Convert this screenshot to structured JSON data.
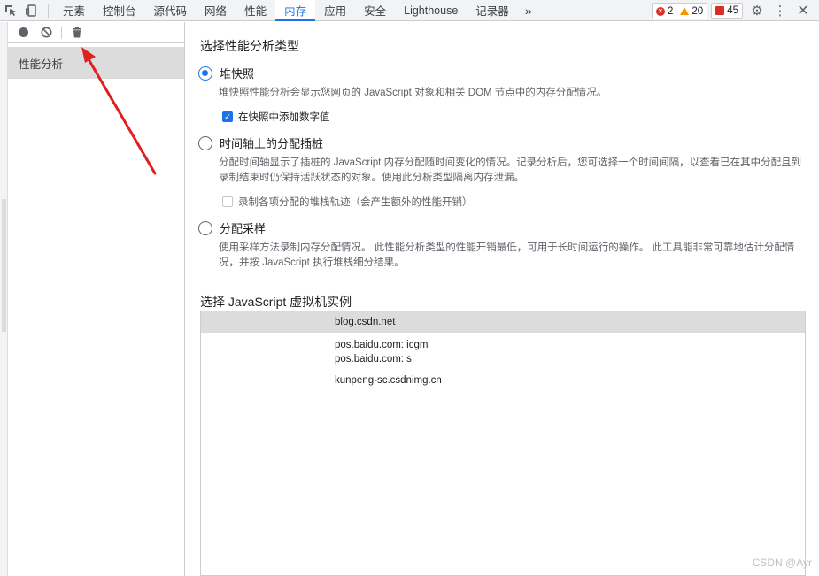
{
  "toolbar": {
    "inspect_icon": "cursor-select-icon",
    "device_icon": "device-toggle-icon",
    "tabs": [
      {
        "label": "元素"
      },
      {
        "label": "控制台"
      },
      {
        "label": "源代码"
      },
      {
        "label": "网络"
      },
      {
        "label": "性能"
      },
      {
        "label": "内存"
      },
      {
        "label": "应用"
      },
      {
        "label": "安全"
      },
      {
        "label": "Lighthouse"
      },
      {
        "label": "记录器"
      }
    ],
    "active_tab": "内存",
    "more_label": "»",
    "errors_count": "2",
    "warnings_count": "20",
    "issues_count": "45"
  },
  "sidebar": {
    "item_label": "性能分析"
  },
  "main": {
    "select_type_title": "选择性能分析类型",
    "options": [
      {
        "label": "堆快照",
        "checked": true,
        "description": "堆快照性能分析会显示您网页的 JavaScript 对象和相关 DOM 节点中的内存分配情况。"
      },
      {
        "label": "时间轴上的分配插桩",
        "checked": false,
        "description": "分配时间轴显示了插桩的 JavaScript 内存分配随时间变化的情况。记录分析后，您可选择一个时间间隔，以查看已在其中分配且到录制结束时仍保持活跃状态的对象。使用此分析类型隔离内存泄漏。"
      },
      {
        "label": "分配采样",
        "checked": false,
        "description": "使用采样方法录制内存分配情况。 此性能分析类型的性能开销最低，可用于长时间运行的操作。 此工具能非常可靠地估计分配情况，并按 JavaScript 执行堆栈细分结果。"
      }
    ],
    "snapshot_checkbox": {
      "label": "在快照中添加数字值",
      "checked": true
    },
    "timeline_checkbox": {
      "label": "录制各项分配的堆栈轨迹（会产生额外的性能开销）",
      "checked": false
    },
    "vm_title": "选择 JavaScript 虚拟机实例",
    "vm_instances": [
      {
        "label": "blog.csdn.net",
        "selected": true
      },
      {
        "label": "pos.baidu.com: icgm",
        "selected": false
      },
      {
        "label": "pos.baidu.com: s",
        "selected": false
      },
      {
        "label": "kunpeng-sc.csdnimg.cn",
        "selected": false
      }
    ]
  },
  "watermark": "CSDN @Ayr"
}
